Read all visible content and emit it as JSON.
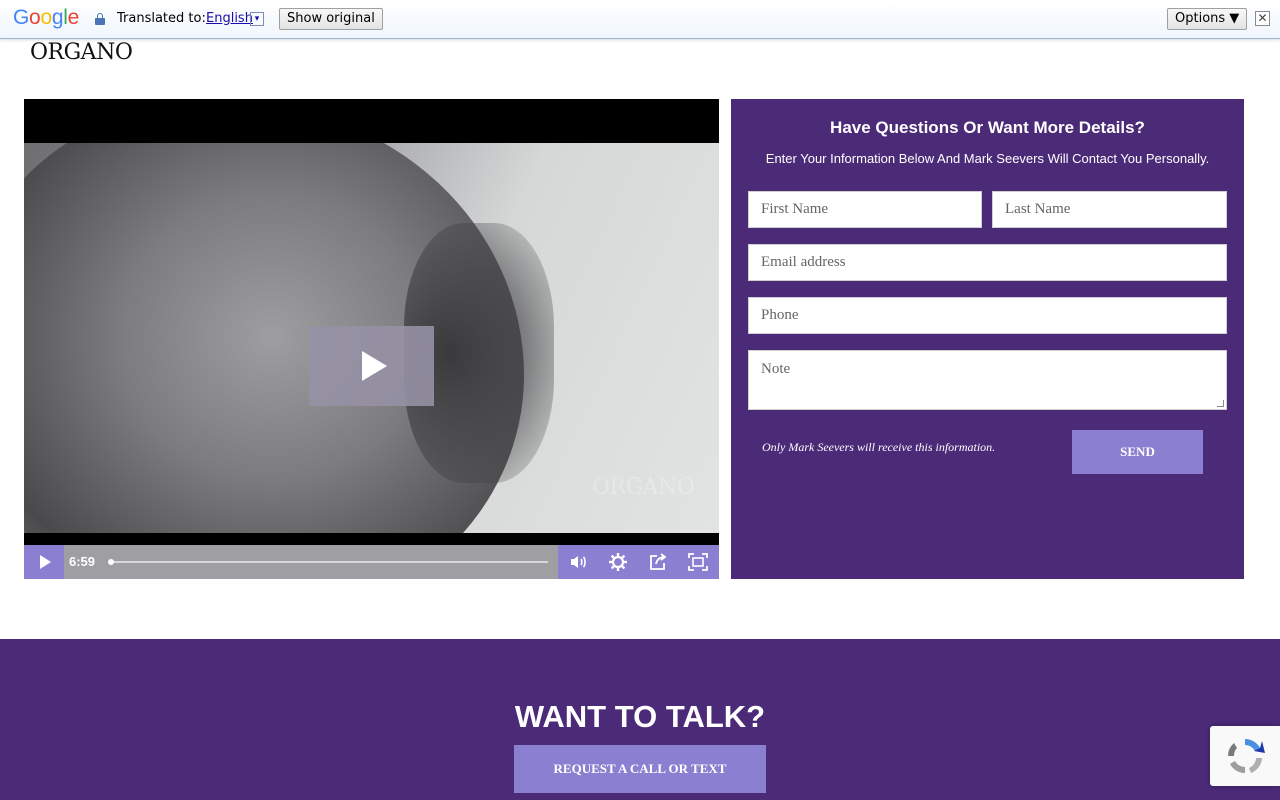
{
  "translate_bar": {
    "logo": [
      "G",
      "o",
      "o",
      "g",
      "l",
      "e"
    ],
    "translated_to_label": "Translated to:",
    "language": "English",
    "language_arrow": "▾",
    "show_original": "Show original",
    "options": "Options ▼",
    "close": "✕"
  },
  "brand": {
    "logo": "ORGANO"
  },
  "video": {
    "watermark": "ORGANO",
    "duration": "6:59",
    "progress": 0
  },
  "form": {
    "title": "Have Questions Or Want More Details?",
    "subtitle": "Enter Your Information Below And Mark Seevers Will Contact You Personally.",
    "first_name_placeholder": "First Name",
    "last_name_placeholder": "Last Name",
    "email_placeholder": "Email address",
    "phone_placeholder": "Phone",
    "note_placeholder": "Note",
    "disclaimer": "Only Mark Seevers will receive this information.",
    "send_label": "SEND"
  },
  "talk": {
    "title": "WANT TO TALK?",
    "button_label": "REQUEST A CALL OR TEXT"
  },
  "colors": {
    "brand_purple": "#4b2a78",
    "accent_lavender": "#8a7fd0"
  },
  "icons": [
    "lock-icon",
    "play-icon",
    "volume-icon",
    "settings-icon",
    "share-icon",
    "fullscreen-icon",
    "recaptcha-icon"
  ]
}
